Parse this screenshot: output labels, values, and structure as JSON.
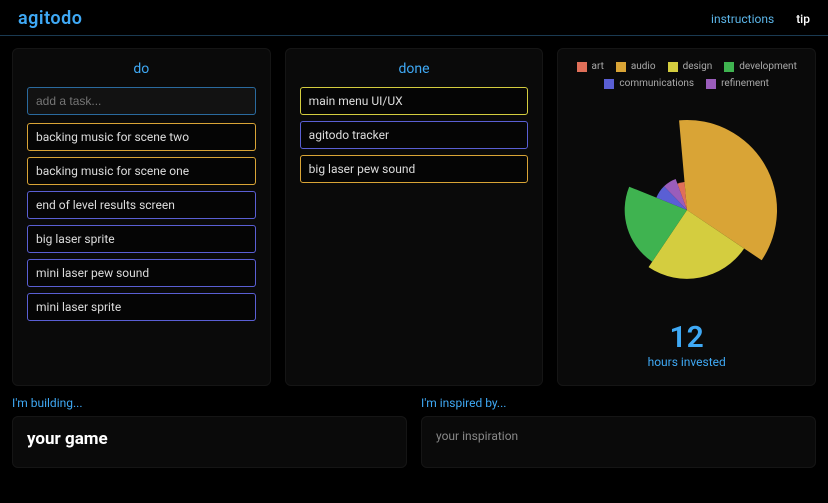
{
  "brand": "agitodo",
  "nav": {
    "instructions": "instructions",
    "tip": "tip"
  },
  "columns": {
    "do": {
      "title": "do",
      "placeholder": "add a task...",
      "tasks": [
        {
          "label": "backing music for scene two",
          "cat": "audio"
        },
        {
          "label": "backing music for scene one",
          "cat": "audio"
        },
        {
          "label": "end of level results screen",
          "cat": "communications"
        },
        {
          "label": "big laser sprite",
          "cat": "communications"
        },
        {
          "label": "mini laser pew sound",
          "cat": "communications"
        },
        {
          "label": "mini laser sprite",
          "cat": "communications"
        }
      ]
    },
    "done": {
      "title": "done",
      "tasks": [
        {
          "label": "main menu UI/UX",
          "cat": "design"
        },
        {
          "label": "agitodo tracker",
          "cat": "communications"
        },
        {
          "label": "big laser pew sound",
          "cat": "audio"
        }
      ]
    }
  },
  "legend": [
    {
      "name": "art",
      "color": "#e06f59"
    },
    {
      "name": "audio",
      "color": "#d9a436"
    },
    {
      "name": "design",
      "color": "#d4cd3f"
    },
    {
      "name": "development",
      "color": "#3fb350"
    },
    {
      "name": "communications",
      "color": "#5a5fd4"
    },
    {
      "name": "refinement",
      "color": "#9a5dbb"
    }
  ],
  "stats": {
    "number": "12",
    "label": "hours invested"
  },
  "building": {
    "label": "I'm building...",
    "value": "your game"
  },
  "inspired": {
    "label": "I'm inspired by...",
    "value": "your inspiration"
  },
  "chart_data": {
    "type": "pie",
    "title": "hours invested",
    "total": 12,
    "series": [
      {
        "name": "art",
        "value": 0.5,
        "color": "#e06f59"
      },
      {
        "name": "audio",
        "value": 4.3,
        "color": "#d9a436"
      },
      {
        "name": "design",
        "value": 3.0,
        "color": "#d4cd3f"
      },
      {
        "name": "development",
        "value": 2.6,
        "color": "#3fb350"
      },
      {
        "name": "communications",
        "value": 0.8,
        "color": "#5a5fd4"
      },
      {
        "name": "refinement",
        "value": 0.8,
        "color": "#9a5dbb"
      }
    ]
  }
}
